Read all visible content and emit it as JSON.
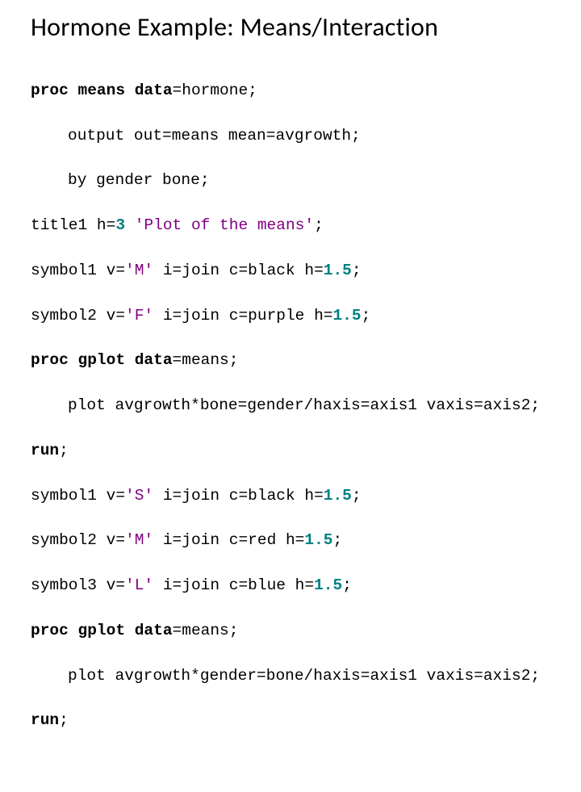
{
  "title": "Hormone Example: Means/Interaction",
  "code": {
    "l1a": "proc",
    "l1b": "means",
    "l1c": "data",
    "l1d": "=hormone;",
    "l2": "output out=means mean=avgrowth;",
    "l3": "by gender bone;",
    "l4a": "title1 h=",
    "l4n": "3",
    "l4s": "'Plot of the means'",
    "l4b": ";",
    "l5a": "symbol1 v=",
    "l5s": "'M'",
    "l5b": " i=join c=black h=",
    "l5n": "1.5",
    "l5c": ";",
    "l6a": "symbol2 v=",
    "l6s": "'F'",
    "l6b": " i=join c=purple h=",
    "l6n": "1.5",
    "l6c": ";",
    "l7a": "proc",
    "l7b": "gplot",
    "l7c": "data",
    "l7d": "=means;",
    "l8": "plot avgrowth*bone=gender/haxis=axis1 vaxis=axis2;",
    "l9": "run",
    "l9b": ";",
    "l10a": "symbol1 v=",
    "l10s": "'S'",
    "l10b": " i=join c=black h=",
    "l10n": "1.5",
    "l10c": ";",
    "l11a": "symbol2 v=",
    "l11s": "'M'",
    "l11b": " i=join c=red h=",
    "l11n": "1.5",
    "l11c": ";",
    "l12a": "symbol3 v=",
    "l12s": "'L'",
    "l12b": " i=join c=blue h=",
    "l12n": "1.5",
    "l12c": ";",
    "l13a": "proc",
    "l13b": "gplot",
    "l13c": "data",
    "l13d": "=means;",
    "l14": "plot avgrowth*gender=bone/haxis=axis1 vaxis=axis2;",
    "l15": "run",
    "l15b": ";"
  }
}
